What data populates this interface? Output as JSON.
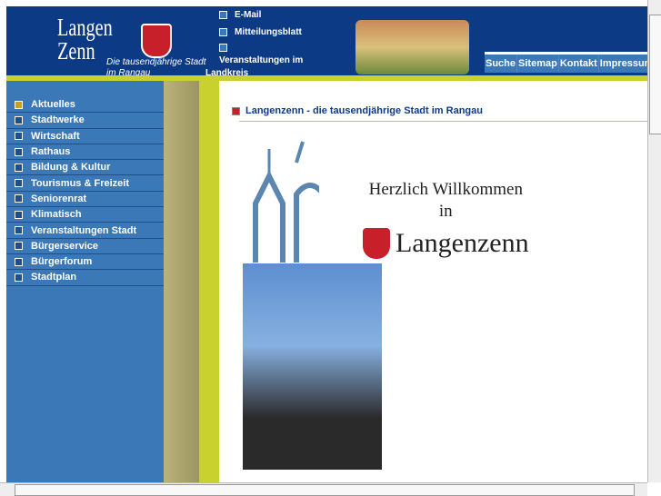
{
  "header": {
    "logo_line1": "Langen",
    "logo_line2": "Zenn",
    "tagline": "Die tausendjährige Stadt im Rangau",
    "top_links": [
      "E-Mail",
      "Mitteilungsblatt",
      "Veranstaltungen im Landkreis"
    ],
    "nav": [
      "Suche",
      "Sitemap",
      "Kontakt",
      "Impressum"
    ]
  },
  "sidebar": {
    "items": [
      "Aktuelles",
      "Stadtwerke",
      "Wirtschaft",
      "Rathaus",
      "Bildung & Kultur",
      "Tourismus & Freizeit",
      "Seniorenrat",
      "Klimatisch",
      "Veranstaltungen Stadt",
      "Bürgerservice",
      "Bürgerforum",
      "Stadtplan"
    ]
  },
  "main": {
    "title": "Langenzenn - die tausendjährige Stadt im Rangau",
    "welcome_line1": "Herzlich Willkommen",
    "welcome_line2": "in",
    "welcome_town": "Langenzenn"
  }
}
